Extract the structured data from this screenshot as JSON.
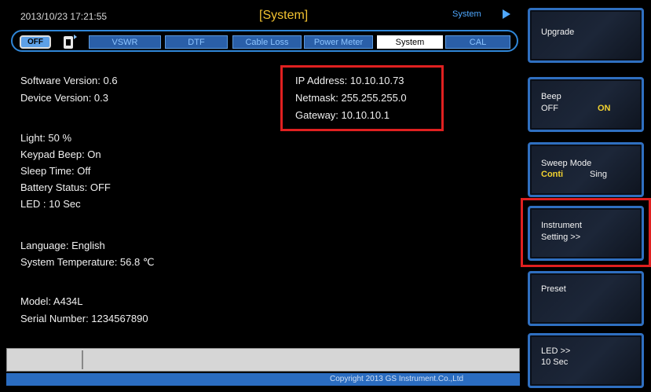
{
  "header": {
    "datetime": "2013/10/23 17:21:55",
    "title": "[System]",
    "breadcrumb": "System"
  },
  "tabs": {
    "off_label": "OFF",
    "items": [
      "VSWR",
      "DTF",
      "Cable Loss",
      "Power Meter",
      "System",
      "CAL"
    ],
    "active": "System"
  },
  "info": {
    "software_version": "Software Version: 0.6",
    "device_version": "Device Version: 0.3",
    "ip_address": "IP Address: 10.10.10.73",
    "netmask": "Netmask: 255.255.255.0",
    "gateway": "Gateway: 10.10.10.1",
    "light": "Light: 50 %",
    "keypad_beep": "Keypad Beep: On",
    "sleep_time": "Sleep Time: Off",
    "battery_status": "Battery Status: OFF",
    "led": "LED : 10 Sec",
    "language": "Language: English",
    "system_temperature": "System Temperature: 56.8 ℃",
    "model": "Model: A434L",
    "serial_number": "Serial Number: 1234567890"
  },
  "softkeys": {
    "upgrade": "Upgrade",
    "beep_label": "Beep",
    "beep_off": "OFF",
    "beep_on": "ON",
    "sweep_label": "Sweep Mode",
    "sweep_conti": "Conti",
    "sweep_sing": "Sing",
    "instrument_line1": "Instrument",
    "instrument_line2": "Setting >>",
    "preset": "Preset",
    "led_line1": "LED >>",
    "led_line2": "10 Sec"
  },
  "footer": {
    "copyright": "Copyright 2013 GS Instrument.Co.,Ltd"
  },
  "colors": {
    "accent_blue": "#2f86d8",
    "highlight_red": "#e02020",
    "title_yellow": "#f2c230"
  }
}
